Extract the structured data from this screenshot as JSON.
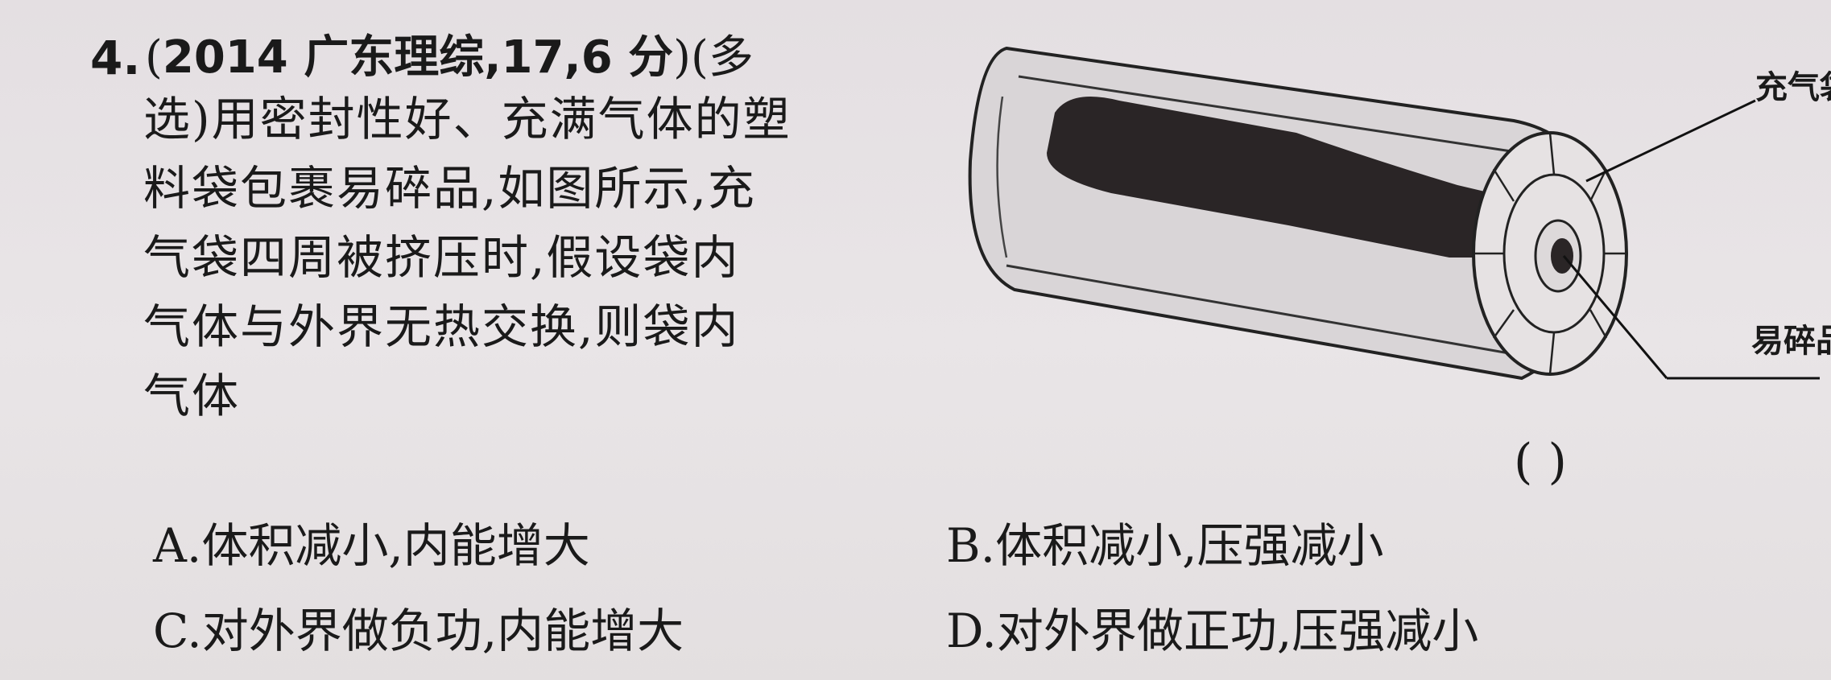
{
  "question": {
    "number": "4.",
    "source_open": "(",
    "source": "2014 广东理综,17,6 分",
    "source_close": ")",
    "type_open": "(多",
    "stem_lines": [
      "选)用密封性好、充满气体的塑",
      "料袋包裹易碎品,如图所示,充",
      "气袋四周被挤压时,假设袋内",
      "气体与外界无热交换,则袋内",
      "气体"
    ],
    "answer_blank": "(          )",
    "options": [
      {
        "label": "A.",
        "text": "体积减小,内能增大"
      },
      {
        "label": "B.",
        "text": "体积减小,压强减小"
      },
      {
        "label": "C.",
        "text": "对外界做负功,内能增大"
      },
      {
        "label": "D.",
        "text": "对外界做正功,压强减小"
      }
    ]
  },
  "figure": {
    "labels": {
      "air_bag": "充气袋",
      "fragile_item": "易碎品"
    }
  }
}
